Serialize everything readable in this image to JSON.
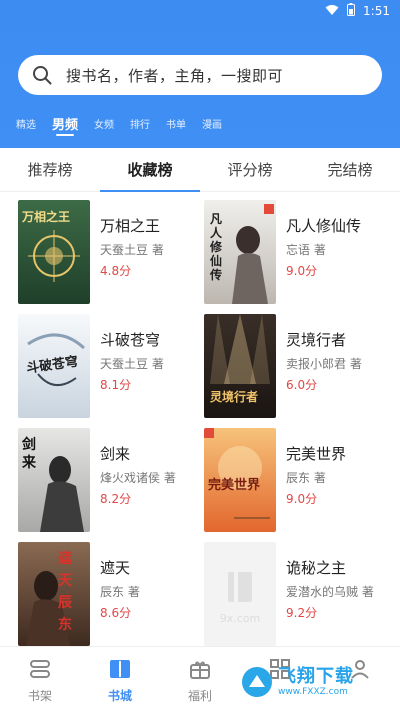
{
  "status": {
    "time": "1:51"
  },
  "search": {
    "placeholder": "搜书名，作者，主角，一搜即可"
  },
  "channels": [
    {
      "label": "精选",
      "active": false
    },
    {
      "label": "男频",
      "active": true
    },
    {
      "label": "女频",
      "active": false
    },
    {
      "label": "排行",
      "active": false
    },
    {
      "label": "书单",
      "active": false
    },
    {
      "label": "漫画",
      "active": false
    }
  ],
  "subtabs": [
    {
      "label": "推荐榜",
      "active": false
    },
    {
      "label": "收藏榜",
      "active": true
    },
    {
      "label": "评分榜",
      "active": false
    },
    {
      "label": "完结榜",
      "active": false
    }
  ],
  "books": [
    {
      "title": "万相之王",
      "author": "天蚕土豆 著",
      "score": "4.8分",
      "cover_text": "万相之王",
      "cover_color": "#2f5d3a"
    },
    {
      "title": "凡人修仙传",
      "author": "忘语 著",
      "score": "9.0分",
      "cover_text": "凡人修仙传",
      "cover_color": "#d9d6d2"
    },
    {
      "title": "斗破苍穹",
      "author": "天蚕土豆 著",
      "score": "8.1分",
      "cover_text": "斗破苍穹",
      "cover_color": "#e9eef4"
    },
    {
      "title": "灵境行者",
      "author": "卖报小郎君 著",
      "score": "6.0分",
      "cover_text": "灵境行者",
      "cover_color": "#2b2320"
    },
    {
      "title": "剑来",
      "author": "烽火戏诸侯 著",
      "score": "8.2分",
      "cover_text": "剑来",
      "cover_color": "#d8d8d6"
    },
    {
      "title": "完美世界",
      "author": "辰东 著",
      "score": "9.0分",
      "cover_text": "完美世界",
      "cover_color": "#e87b3a"
    },
    {
      "title": "遮天",
      "author": "辰东 著",
      "score": "8.6分",
      "cover_text": "遮天 辰东",
      "cover_color": "#6b4a3a"
    },
    {
      "title": "诡秘之主",
      "author": "爱潜水的乌贼 著",
      "score": "9.2分",
      "cover_text": "9x.com",
      "cover_color": "#f3f3f3"
    }
  ],
  "tabbar": [
    {
      "label": "书架",
      "icon": "bookshelf-icon",
      "active": false
    },
    {
      "label": "书城",
      "icon": "book-open-icon",
      "active": true
    },
    {
      "label": "福利",
      "icon": "gift-icon",
      "active": false
    },
    {
      "label": "",
      "icon": "grid-icon",
      "active": false
    },
    {
      "label": "",
      "icon": "user-icon",
      "active": false
    }
  ],
  "watermark": {
    "title": "飞翔下载",
    "url": "www.FXXZ.com"
  },
  "colors": {
    "brand": "#3f8ff4",
    "score": "#e04848"
  }
}
